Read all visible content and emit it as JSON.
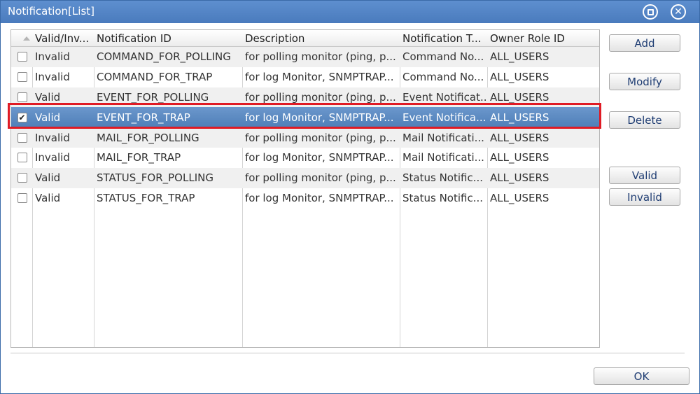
{
  "window": {
    "title": "Notification[List]"
  },
  "table": {
    "columns": [
      "Valid/Inv...",
      "Notification ID",
      "Description",
      "Notification T...",
      "Owner Role ID"
    ],
    "rows": [
      {
        "checked": false,
        "valid": "Invalid",
        "id": "COMMAND_FOR_POLLING",
        "description": "for polling monitor (ping, p...",
        "type": "Command No...",
        "owner": "ALL_USERS"
      },
      {
        "checked": false,
        "valid": "Invalid",
        "id": "COMMAND_FOR_TRAP",
        "description": "for log Monitor, SNMPTRAP...",
        "type": "Command No...",
        "owner": "ALL_USERS"
      },
      {
        "checked": false,
        "valid": "Valid",
        "id": "EVENT_FOR_POLLING",
        "description": "for polling monitor (ping, p...",
        "type": "Event Notificat...",
        "owner": "ALL_USERS"
      },
      {
        "checked": true,
        "valid": "Valid",
        "id": "EVENT_FOR_TRAP",
        "description": "for log Monitor, SNMPTRAP...",
        "type": "Event Notifica...",
        "owner": "ALL_USERS"
      },
      {
        "checked": false,
        "valid": "Invalid",
        "id": "MAIL_FOR_POLLING",
        "description": "for polling monitor (ping, p...",
        "type": "Mail Notificati...",
        "owner": "ALL_USERS"
      },
      {
        "checked": false,
        "valid": "Invalid",
        "id": "MAIL_FOR_TRAP",
        "description": "for log Monitor, SNMPTRAP...",
        "type": "Mail Notificati...",
        "owner": "ALL_USERS"
      },
      {
        "checked": false,
        "valid": "Valid",
        "id": "STATUS_FOR_POLLING",
        "description": "for polling monitor (ping, p...",
        "type": "Status Notific...",
        "owner": "ALL_USERS"
      },
      {
        "checked": false,
        "valid": "Valid",
        "id": "STATUS_FOR_TRAP",
        "description": "for log Monitor, SNMPTRAP...",
        "type": "Status Notific...",
        "owner": "ALL_USERS"
      }
    ],
    "check_glyph": "✔"
  },
  "buttons": {
    "add": "Add",
    "modify": "Modify",
    "delete": "Delete",
    "valid": "Valid",
    "invalid": "Invalid",
    "ok": "OK"
  },
  "icons": {
    "restore": "restore-icon",
    "close": "close-icon",
    "close_glyph": "✕"
  },
  "colors": {
    "titlebar": "#4a7bbd",
    "selection": "#4f7fb8",
    "highlight_outline": "#e01b24",
    "button_text": "#1f3d73"
  }
}
